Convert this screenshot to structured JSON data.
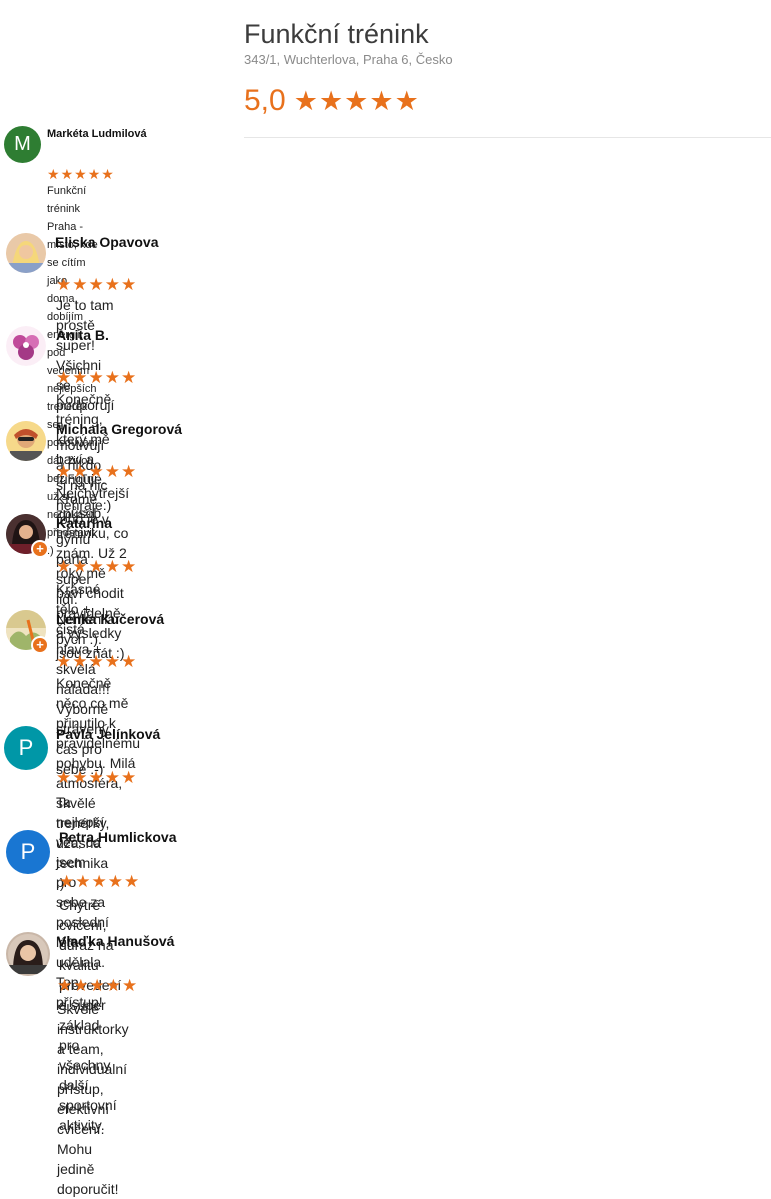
{
  "business": {
    "name": "Funkční trénink",
    "address": "343/1, Wuchterlova, Praha 6, Česko",
    "rating": "5,0",
    "stars": 5
  },
  "colors": {
    "accent": "#e8711c",
    "avatar_m": "#2e7d32",
    "avatar_p": "#0097a7",
    "avatar_p2": "#1976d2"
  },
  "reviews": [
    {
      "name": "Markéta Ludmilová",
      "avatar_letter": "M",
      "stars": 5,
      "text_line1": "Funkční trénink Praha - místo, kde se cítím jako doma, dobíjím energii, pod vedením nejlepších trenérek",
      "text_line2": "se posouvám dál, život bez FuTru už si nedokážu představit :)"
    },
    {
      "name": "Eliska Opavova",
      "avatar_icon": "blonde-woman-avatar-icon",
      "stars": 5,
      "text": "Je to tam prostě super! Všichni se podporují a motivují a nikdo si na nic nehraje:)"
    },
    {
      "name": "Anita B.",
      "avatar_icon": "pink-flower-avatar-icon",
      "stars": 5,
      "text": "Konečně tréning, který mě baví a funguje. Kromě toho je v gymu parta super lidí. Neměnila bych :)."
    },
    {
      "name": "Michala Gregorová",
      "avatar_icon": "woman-sunglasses-avatar-icon",
      "stars": 5,
      "text": "Nejchytřejší způsob tréninku, co znám. Už 2 roky mě baví chodit pravidelně a výsledky jsou znát :)"
    },
    {
      "name": "Katarína",
      "avatar_icon": "woman-dark-hair-avatar-icon",
      "stars": 5,
      "local_guide": true,
      "text": "Krásné tělo + čistá hlava + skvělá nálada!!! Výborně strávený čas pro sebe :-)"
    },
    {
      "name": "Lenka Kučerová",
      "avatar_icon": "outdoor-photo-avatar-icon",
      "stars": 5,
      "local_guide": true,
      "text_line1": "Konečně něco co mě přinutilo k pravidelnému pohybu. Milá atmosféra, skvělé trenérky, úžasná technika",
      "text_line2": ":)"
    },
    {
      "name": "Pavla Jelínková",
      "avatar_letter": "P",
      "stars": 5,
      "text": "Ta nejlepší věc, co jsem  pro sebe za poslední léta udělala. Top přístup!"
    },
    {
      "name": "Petra Humlickova",
      "avatar_letter": "P",
      "stars": 5,
      "text": "Chytré cvičení, důraz na kvalitu provedení a super základ pro všechny další sportovní aktivity."
    },
    {
      "name": "Vlaďka Hanušová",
      "avatar_icon": "woman-portrait-avatar-icon",
      "stars": 5,
      "text": "Skvělé instruktorky a team, individuální přístup, efektivní cvičení. Mohu jedině doporučit!"
    }
  ]
}
